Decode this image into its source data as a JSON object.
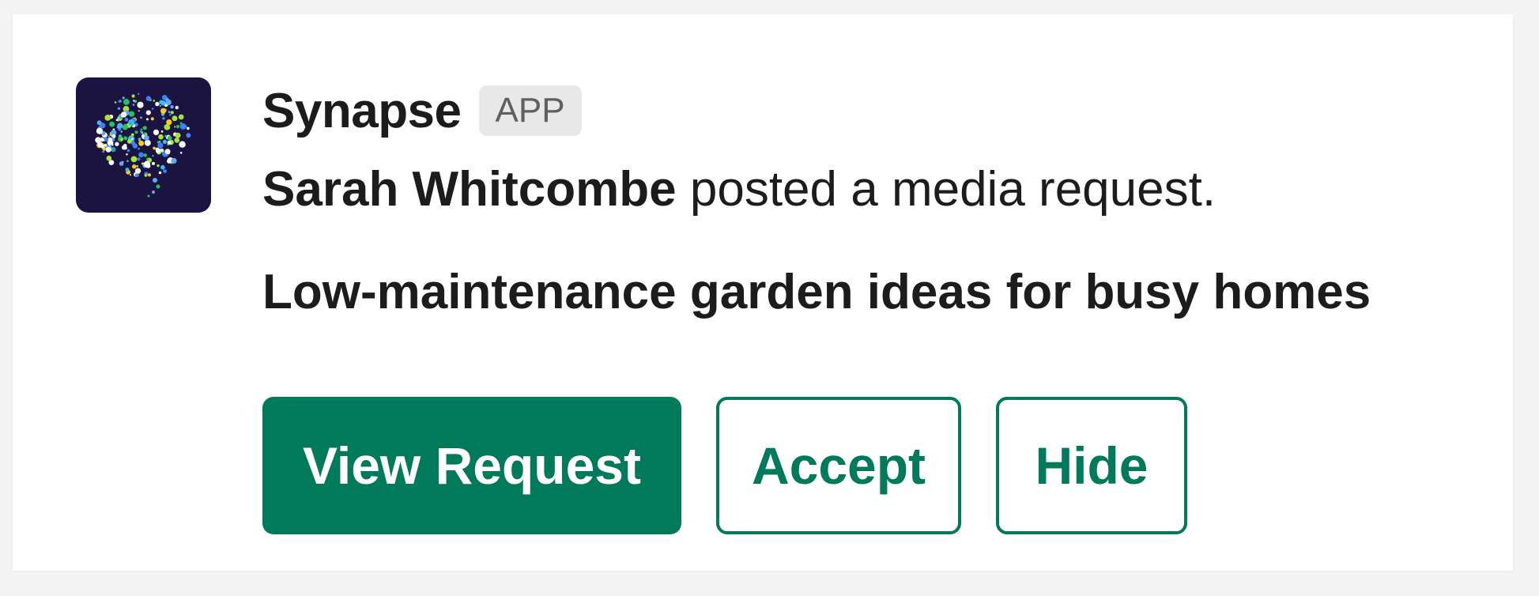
{
  "message": {
    "app_name": "Synapse",
    "app_badge": "APP",
    "poster_name": "Sarah Whitcombe",
    "action_text": " posted a media request.",
    "request_title": "Low-maintenance garden ideas for busy homes"
  },
  "actions": {
    "view_label": "View Request",
    "accept_label": "Accept",
    "hide_label": "Hide"
  },
  "colors": {
    "accent": "#007a5a",
    "avatar_bg": "#1b1440",
    "badge_bg": "#e8e8e8"
  },
  "icons": {
    "avatar": "speech-bubble-dots-logo"
  }
}
